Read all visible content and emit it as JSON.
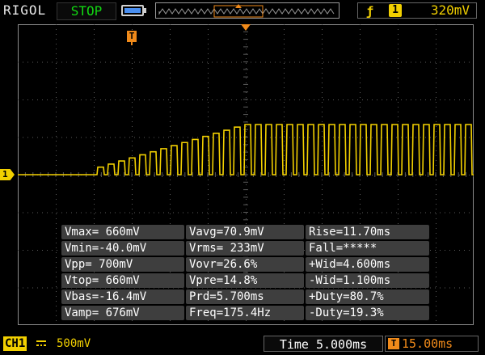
{
  "header": {
    "brand": "RIGOL",
    "run_state": "STOP",
    "trigger_edge_icon": "rising-edge-icon",
    "trigger_channel": "1",
    "trigger_level": "320mV"
  },
  "colors": {
    "channel1": "#f2d000",
    "trigger": "#f08a1a",
    "run_state": "#12d812",
    "grid": "#5a5a5a",
    "measurement_bg": "#3e3e3e"
  },
  "screen": {
    "trigger_marker": "T",
    "channel_marker": "1"
  },
  "measurements": [
    [
      "Vmax= 660mV",
      "Vavg=70.9mV",
      "Rise=11.70ms"
    ],
    [
      "Vmin=-40.0mV",
      "Vrms= 233mV",
      "Fall=*****"
    ],
    [
      "Vpp= 700mV",
      "Vovr=26.6%",
      "+Wid=4.600ms"
    ],
    [
      "Vtop= 660mV",
      "Vpre=14.8%",
      "-Wid=1.100ms"
    ],
    [
      "Vbas=-16.4mV",
      "Prd=5.700ms",
      "+Duty=80.7%"
    ],
    [
      "Vamp= 676mV",
      "Freq=175.4Hz",
      "-Duty=19.3%"
    ]
  ],
  "footer": {
    "channel_label": "CH1",
    "coupling_icon": "dc-coupling-icon",
    "volts_per_div": "500mV",
    "timebase": "Time 5.000ms",
    "trigger_delay_icon": "T",
    "trigger_delay": "15.00ms"
  }
}
